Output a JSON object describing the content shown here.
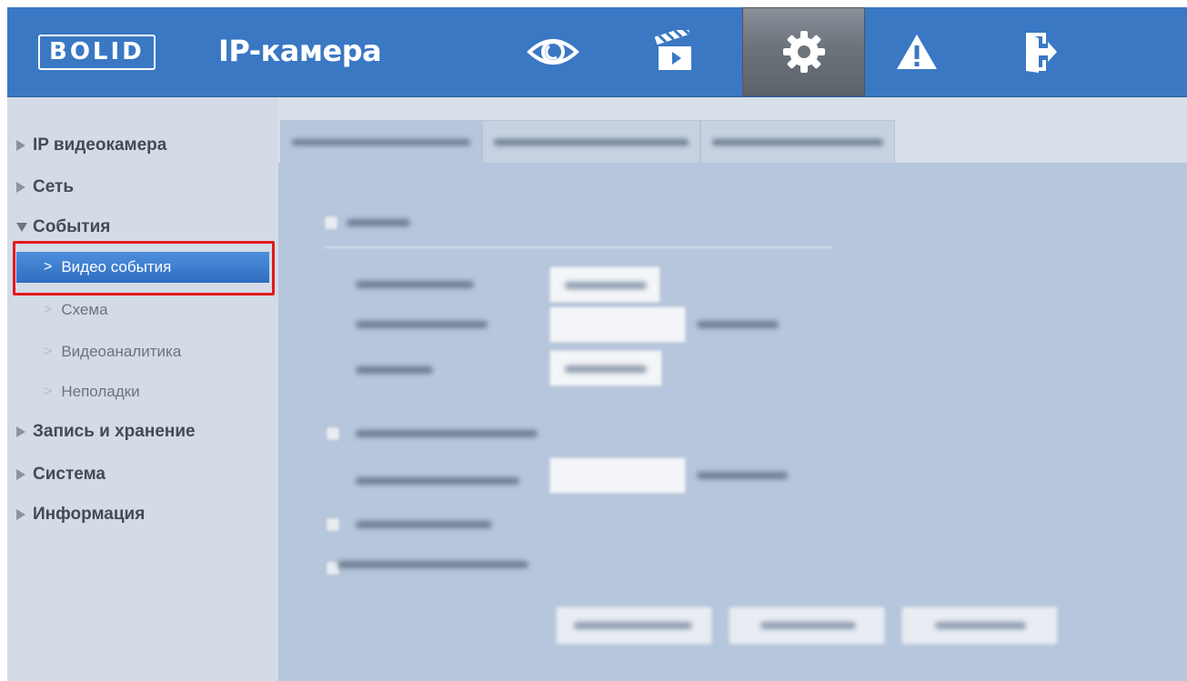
{
  "header": {
    "logo": "BOLID",
    "title": "IP-камера",
    "nav": [
      {
        "icon": "eye-icon",
        "label": ""
      },
      {
        "icon": "clapperboard-icon",
        "label": ""
      },
      {
        "icon": "gear-icon",
        "label": "",
        "active": true
      },
      {
        "icon": "warning-icon",
        "label": ""
      },
      {
        "icon": "logout-icon",
        "label": ""
      }
    ],
    "colors": {
      "bar": "#3a78c4",
      "active_tab": "#6d737b"
    }
  },
  "sidebar": {
    "items": [
      {
        "label": "IP видеокамера"
      },
      {
        "label": "Сеть"
      },
      {
        "label": "События",
        "expanded": true
      },
      {
        "label": "Запись и хранение"
      },
      {
        "label": "Система"
      },
      {
        "label": "Информация"
      }
    ],
    "sub_items": [
      {
        "label": "Видео события",
        "active": true
      },
      {
        "label": "Схема"
      },
      {
        "label": "Видеоаналитика"
      },
      {
        "label": "Неполадки"
      }
    ],
    "highlight_color": "#e01c1c"
  }
}
